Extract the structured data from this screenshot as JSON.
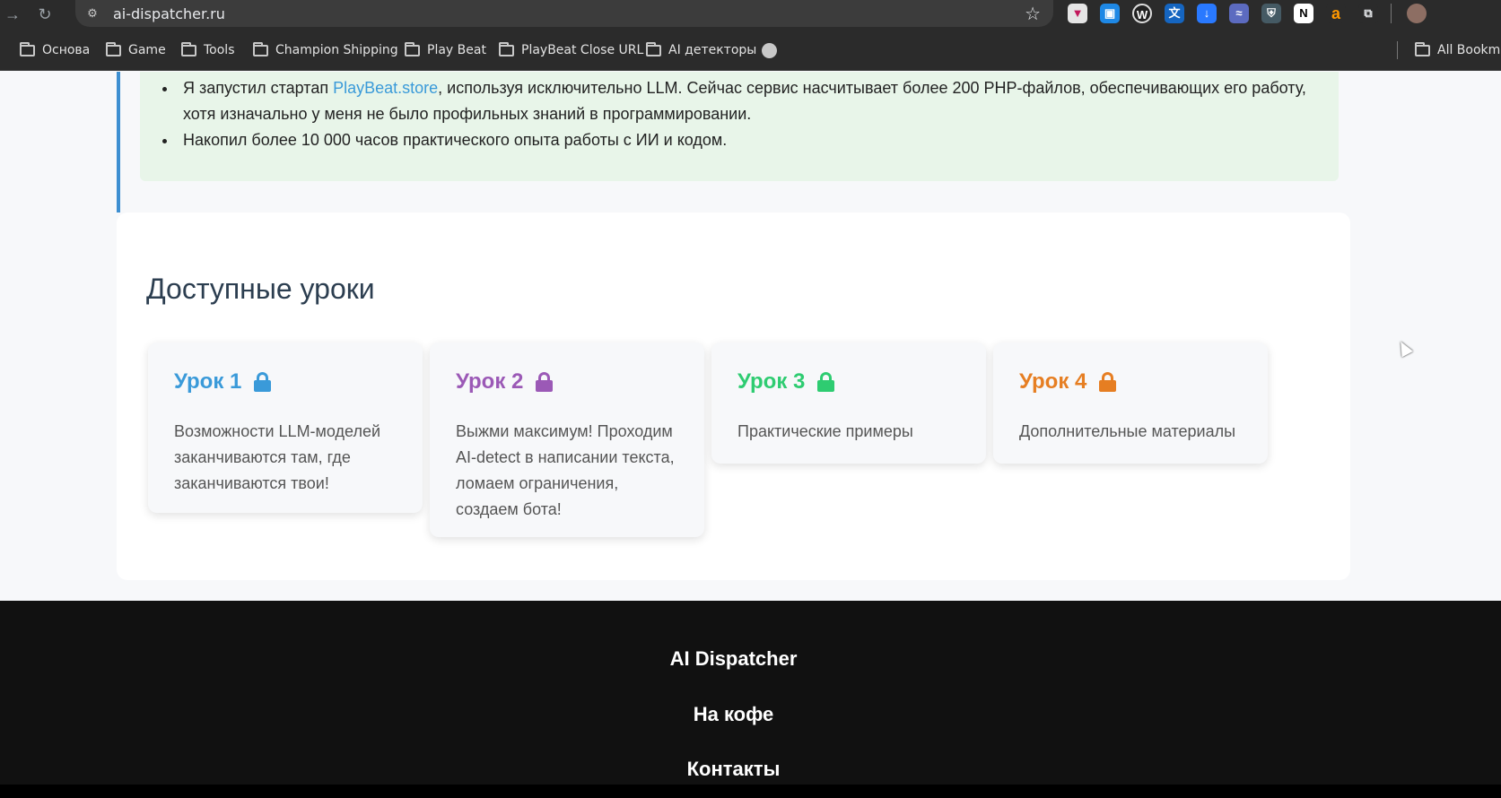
{
  "browser": {
    "url": "ai-dispatcher.ru",
    "bookmarks": [
      {
        "label": "Основа",
        "type": "folder"
      },
      {
        "label": "Game",
        "type": "folder"
      },
      {
        "label": "Tools",
        "type": "folder"
      },
      {
        "label": "Champion Shipping",
        "type": "folder"
      },
      {
        "label": "Play Beat",
        "type": "folder"
      },
      {
        "label": "PlayBeat Close URL",
        "type": "folder"
      },
      {
        "label": "AI детекторы",
        "type": "folder"
      },
      {
        "label": "",
        "type": "globe"
      }
    ],
    "all_bookmarks_label": "All Bookma"
  },
  "experience": {
    "item1_prefix": "Я запустил стартап ",
    "item1_link": "PlayBeat.store",
    "item1_suffix": ", используя исключительно LLM. Сейчас сервис насчитывает более 200 PHP-файлов, обеспечивающих его работу, хотя изначально у меня не было профильных знаний в программировании.",
    "item2": "Накопил более 10 000 часов практического опыта работы с ИИ и кодом."
  },
  "lessons": {
    "title": "Доступные уроки",
    "cards": [
      {
        "title": "Урок 1",
        "description": "Возможности LLM-моделей заканчиваются там, где заканчиваются твои!",
        "color": "#3a9ad9",
        "icon": "lock-icon"
      },
      {
        "title": "Урок 2",
        "description": "Выжми максимум! Проходим AI-detect в написании текста, ломаем ограничения, создаем бота!",
        "color": "#9b59b6",
        "icon": "lock-icon"
      },
      {
        "title": "Урок 3",
        "description": "Практические примеры",
        "color": "#2ecc71",
        "icon": "lock-icon"
      },
      {
        "title": "Урок 4",
        "description": "Дополнительные материалы",
        "color": "#e67e22",
        "icon": "lock-icon"
      }
    ]
  },
  "footer": {
    "brand": "AI Dispatcher",
    "coffee": "На кофе",
    "contacts": "Контакты"
  }
}
